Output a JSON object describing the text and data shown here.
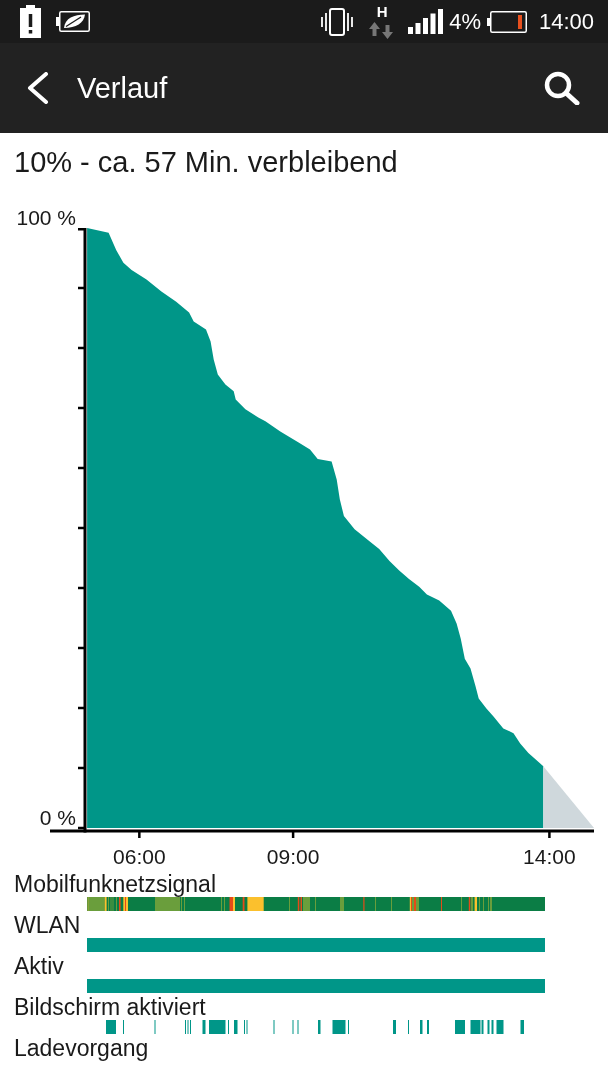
{
  "status_bar": {
    "network_type": "H",
    "battery_percent": "4%",
    "time": "14:00"
  },
  "app_bar": {
    "title": "Verlauf"
  },
  "summary": "10% - ca. 57 Min. verbleibend",
  "battery_chart": {
    "chart_data": {
      "type": "area",
      "x": [
        4.98,
        5.4,
        5.55,
        5.69,
        5.85,
        6.14,
        6.43,
        6.72,
        6.97,
        7.06,
        7.3,
        7.39,
        7.45,
        7.53,
        7.68,
        7.84,
        7.88,
        8.07,
        8.32,
        8.46,
        8.75,
        9.1,
        9.33,
        9.48,
        9.75,
        9.85,
        9.91,
        9.99,
        10.2,
        10.49,
        10.68,
        10.88,
        11.07,
        11.26,
        11.46,
        11.61,
        11.85,
        12.08,
        12.19,
        12.27,
        12.35,
        12.46,
        12.56,
        12.62,
        12.77,
        12.91,
        13.1,
        13.3,
        13.43,
        13.59,
        13.88,
        14.87
      ],
      "series": [
        {
          "color": "#009688",
          "values": [
            100,
            99.2,
            96.3,
            94.2,
            93.0,
            91.4,
            89.4,
            87.7,
            85.9,
            84.4,
            83.1,
            81.1,
            78.1,
            75.6,
            73.9,
            72.8,
            71.4,
            69.8,
            68.4,
            67.8,
            66.1,
            64.3,
            63.1,
            61.5,
            61.1,
            58.1,
            54.8,
            52.0,
            49.8,
            47.8,
            46.5,
            44.5,
            42.9,
            41.5,
            40.2,
            38.9,
            37.9,
            36.2,
            34.1,
            31.6,
            28.2,
            26.6,
            23.6,
            21.6,
            19.9,
            18.6,
            16.6,
            15.8,
            14.1,
            12.5,
            10.3,
            null
          ]
        },
        {
          "color": "#cfd8dc",
          "values": [
            null,
            null,
            null,
            null,
            null,
            null,
            null,
            null,
            null,
            null,
            null,
            null,
            null,
            null,
            null,
            null,
            null,
            null,
            null,
            null,
            null,
            null,
            null,
            null,
            null,
            null,
            null,
            null,
            null,
            null,
            null,
            null,
            null,
            null,
            null,
            null,
            null,
            null,
            null,
            null,
            null,
            null,
            null,
            null,
            null,
            null,
            null,
            null,
            null,
            null,
            10.3,
            0
          ]
        }
      ],
      "xlim": [
        4.94,
        14.87
      ],
      "ylim": [
        0,
        100
      ],
      "xticks": [
        {
          "value": 6,
          "label": "06:00"
        },
        {
          "value": 9,
          "label": "09:00"
        },
        {
          "value": 14,
          "label": "14:00"
        }
      ],
      "yticks": [
        {
          "value": 0,
          "label": "0 %"
        },
        {
          "value": 100,
          "label": "100 %"
        }
      ]
    }
  },
  "timelines": [
    {
      "label": "Mobilfunknetzsignal",
      "kind": "signal"
    },
    {
      "label": "WLAN",
      "kind": "full"
    },
    {
      "label": "Aktiv",
      "kind": "full"
    },
    {
      "label": "Bildschirm aktiviert",
      "kind": "segments"
    },
    {
      "label": "Ladevorgang",
      "kind": "empty"
    }
  ]
}
